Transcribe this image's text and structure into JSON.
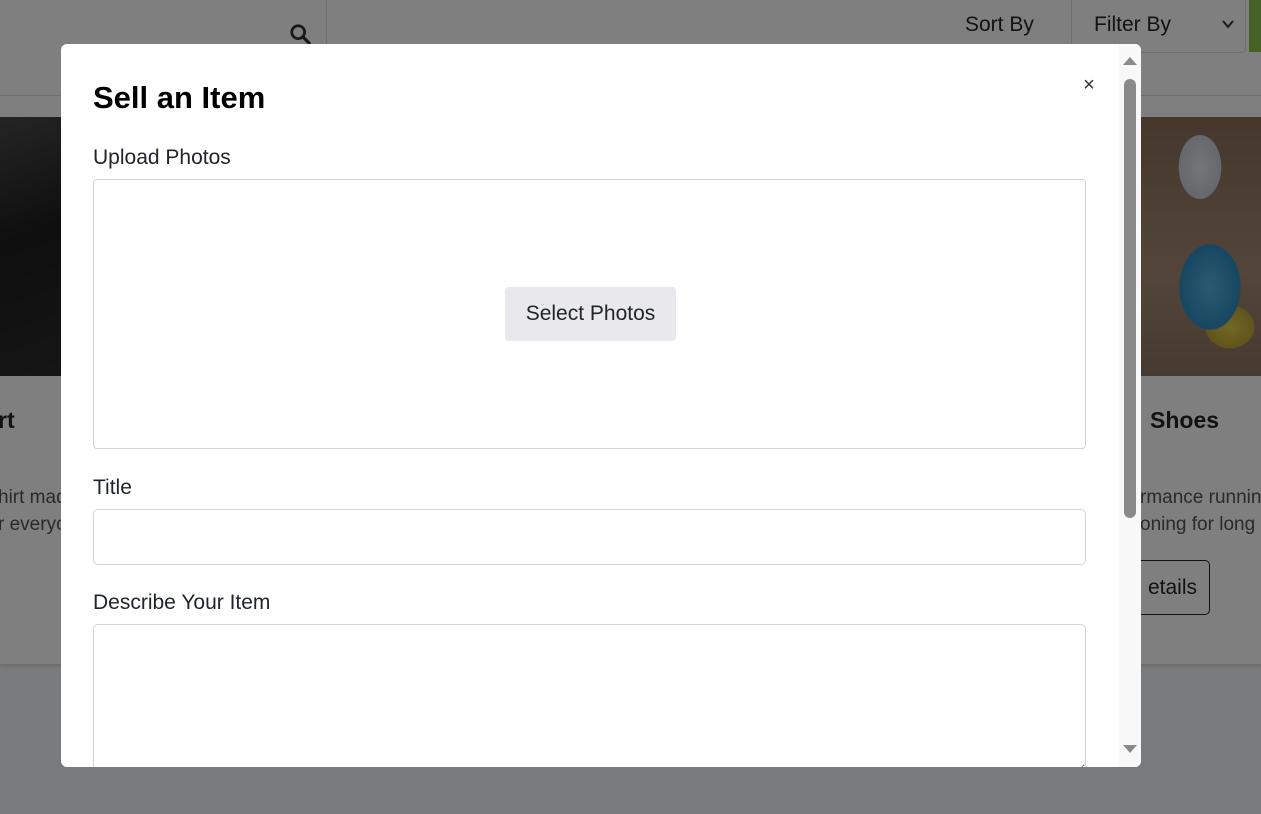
{
  "background": {
    "sort_label": "Sort By",
    "filter_label": "Filter By",
    "cards": [
      {
        "title_fragment": "rt",
        "desc_line1": "hirt mad",
        "desc_line2": "r everyo"
      },
      {
        "title_fragment": "Shoes",
        "desc_line1": "rmance runnin",
        "desc_line2": "oning for long",
        "button_label": "etails"
      }
    ]
  },
  "modal": {
    "title": "Sell an Item",
    "close_glyph": "×",
    "upload": {
      "label": "Upload Photos",
      "button_label": "Select Photos"
    },
    "title_field": {
      "label": "Title",
      "value": ""
    },
    "description_field": {
      "label": "Describe Your Item",
      "value": ""
    }
  },
  "icons": {
    "search": "search-icon",
    "close": "close-icon",
    "chevron": "chevron-down-icon"
  }
}
